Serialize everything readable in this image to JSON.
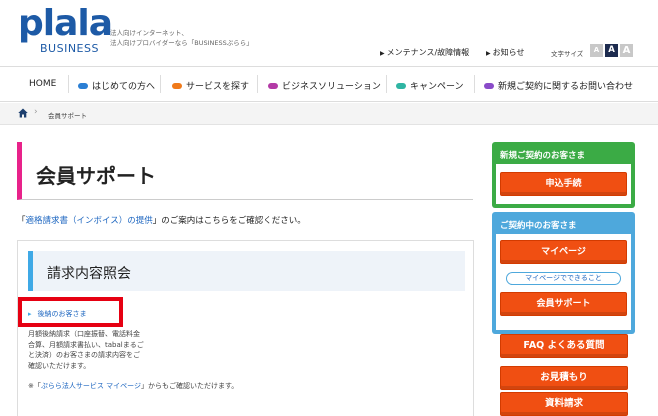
{
  "header": {
    "logo_main": "plala",
    "logo_sub": "BUSINESS",
    "tagline_1": "法人向けインターネット、",
    "tagline_2": "法人向けプロバイダーなら「BUSINESSぷらら」",
    "maintenance": "メンテナンス/故障情報",
    "news": "お知らせ",
    "font_size_label": "文字サイズ",
    "font_sizes": [
      "A",
      "A",
      "A"
    ]
  },
  "nav": {
    "items": [
      {
        "label": "HOME",
        "color": ""
      },
      {
        "label": "はじめての方へ",
        "color": "#2b7fd4"
      },
      {
        "label": "サービスを探す",
        "color": "#f07a1a"
      },
      {
        "label": "ビジネスソリューション",
        "color": "#b33aa6"
      },
      {
        "label": "キャンペーン",
        "color": "#2fb5a3"
      },
      {
        "label": "新規ご契約に関するお問い合わせ",
        "color": "#8a4bc9"
      }
    ]
  },
  "breadcrumb": {
    "current": "会員サポート"
  },
  "main": {
    "page_title": "会員サポート",
    "notice_prefix": "「",
    "notice_link": "適格請求書（インボイス）の提供",
    "notice_suffix": "」のご案内はこちらをご確認ください。",
    "section_title": "請求内容照会",
    "sub_link": "後納のお客さま",
    "desc_lines": [
      "月額後納請求（口座振替、電話料金",
      "合算、月額請求書払い、tabalまるご",
      "と決済）のお客さまの請求内容をご",
      "確認いただけます。"
    ],
    "note_prefix": "※「",
    "note_link": "ぷらら法人サービス マイページ",
    "note_suffix": "」からもご確認いただけます。"
  },
  "sidebar": {
    "new_heading": "新規ご契約のお客さま",
    "apply_label": "申込手続",
    "current_heading": "ご契約中のお客さま",
    "mypage_label": "マイページ",
    "mypage_can_label": "マイページでできること",
    "support_label": "会員サポート",
    "faq_label": "FAQ よくある質問",
    "estimate_label": "お見積もり",
    "docs_label": "資料請求"
  },
  "colors": {
    "brand_blue": "#1d5aa6",
    "accent_pink": "#e8228a",
    "highlight_red": "#e60012",
    "button_orange": "#f04f12",
    "sidebar_green": "#3bab45",
    "sidebar_blue": "#4ea8dc"
  }
}
